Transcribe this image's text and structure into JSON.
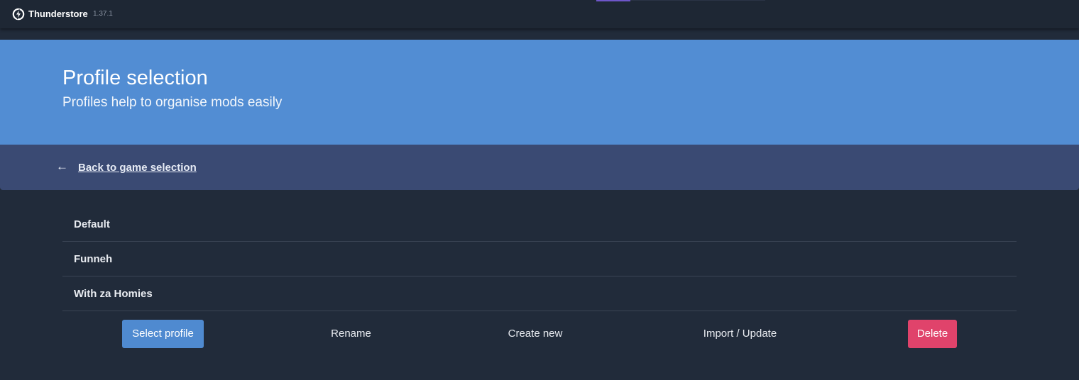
{
  "titlebar": {
    "app_name": "Thunderstore",
    "version": "1.37.1",
    "logo_icon": "thunderstore-logo-icon"
  },
  "hero": {
    "title": "Profile selection",
    "subtitle": "Profiles help to organise mods easily"
  },
  "back": {
    "arrow": "←",
    "label": "Back to game selection"
  },
  "profiles": [
    {
      "name": "Default"
    },
    {
      "name": "Funneh"
    },
    {
      "name": "With za Homies"
    }
  ],
  "actions": {
    "select": "Select profile",
    "rename": "Rename",
    "create": "Create new",
    "import": "Import / Update",
    "delete": "Delete"
  },
  "colors": {
    "background": "#212b3a",
    "titlebar": "#1e2734",
    "hero": "#528dd3",
    "backbar": "#3a4a73",
    "primary_button": "#4f8ad0",
    "danger_button": "#e0436b"
  }
}
